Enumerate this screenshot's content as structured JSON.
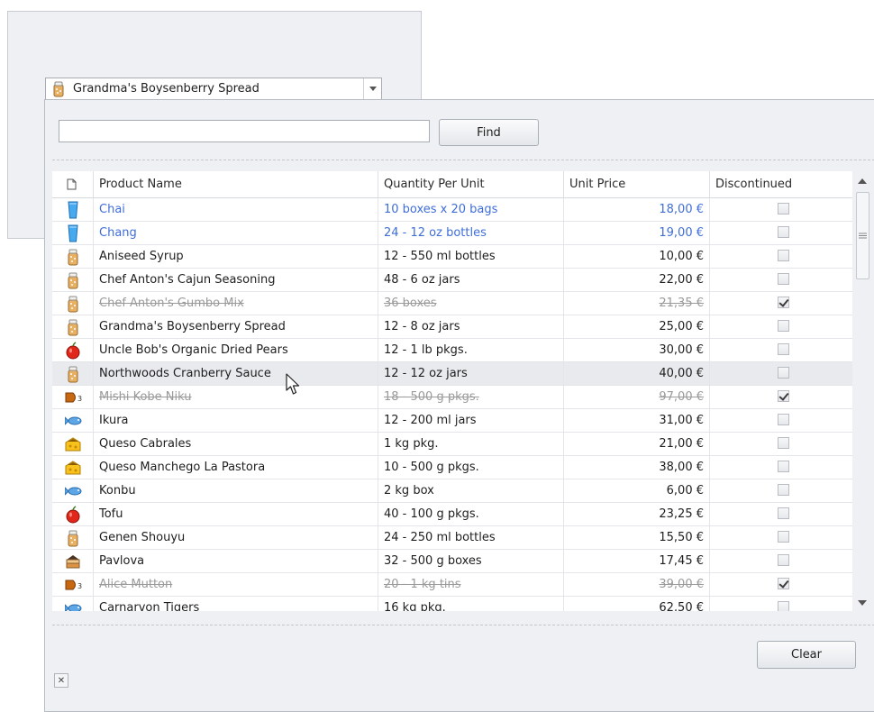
{
  "lookup": {
    "selected_value": "Grandma's Boysenberry Spread",
    "selected_icon": "jar-icon"
  },
  "popup": {
    "search_value": "",
    "find_label": "Find",
    "clear_label": "Clear",
    "close_glyph": "✕"
  },
  "grid": {
    "columns": [
      {
        "key": "icon",
        "label": ""
      },
      {
        "key": "name",
        "label": "Product Name"
      },
      {
        "key": "qty",
        "label": "Quantity Per Unit"
      },
      {
        "key": "price",
        "label": "Unit Price"
      },
      {
        "key": "disc",
        "label": "Discontinued"
      }
    ],
    "rows": [
      {
        "icon": "beverage-icon",
        "name": "Chai",
        "qty": "10 boxes x 20 bags",
        "price": "18,00 €",
        "discontinued": false,
        "style": "blue"
      },
      {
        "icon": "beverage-icon",
        "name": "Chang",
        "qty": "24 - 12 oz bottles",
        "price": "19,00 €",
        "discontinued": false,
        "style": "blue"
      },
      {
        "icon": "condiment-jar-icon",
        "name": "Aniseed Syrup",
        "qty": "12 - 550 ml bottles",
        "price": "10,00 €",
        "discontinued": false,
        "style": "normal"
      },
      {
        "icon": "condiment-jar-icon",
        "name": "Chef Anton's Cajun Seasoning",
        "qty": "48 - 6 oz jars",
        "price": "22,00 €",
        "discontinued": false,
        "style": "normal"
      },
      {
        "icon": "condiment-jar-icon",
        "name": "Chef Anton's Gumbo Mix",
        "qty": "36 boxes",
        "price": "21,35 €",
        "discontinued": true,
        "style": "strike"
      },
      {
        "icon": "condiment-jar-icon",
        "name": "Grandma's Boysenberry Spread",
        "qty": "12 - 8 oz jars",
        "price": "25,00 €",
        "discontinued": false,
        "style": "normal"
      },
      {
        "icon": "apple-icon",
        "name": "Uncle Bob's Organic Dried Pears",
        "qty": "12 - 1 lb pkgs.",
        "price": "30,00 €",
        "discontinued": false,
        "style": "normal"
      },
      {
        "icon": "condiment-jar-icon",
        "name": "Northwoods Cranberry Sauce",
        "qty": "12 - 12 oz jars",
        "price": "40,00 €",
        "discontinued": false,
        "style": "hover"
      },
      {
        "icon": "meat-icon",
        "name": "Mishi Kobe Niku",
        "qty": "18 - 500 g pkgs.",
        "price": "97,00 €",
        "discontinued": true,
        "style": "strike"
      },
      {
        "icon": "fish-icon",
        "name": "Ikura",
        "qty": "12 - 200 ml jars",
        "price": "31,00 €",
        "discontinued": false,
        "style": "normal"
      },
      {
        "icon": "cheese-icon",
        "name": "Queso Cabrales",
        "qty": "1 kg pkg.",
        "price": "21,00 €",
        "discontinued": false,
        "style": "normal"
      },
      {
        "icon": "cheese-icon",
        "name": "Queso Manchego La Pastora",
        "qty": "10 - 500 g pkgs.",
        "price": "38,00 €",
        "discontinued": false,
        "style": "normal"
      },
      {
        "icon": "fish-icon",
        "name": "Konbu",
        "qty": "2 kg box",
        "price": "6,00 €",
        "discontinued": false,
        "style": "normal"
      },
      {
        "icon": "apple-icon",
        "name": "Tofu",
        "qty": "40 - 100 g pkgs.",
        "price": "23,25 €",
        "discontinued": false,
        "style": "normal"
      },
      {
        "icon": "condiment-jar-icon",
        "name": "Genen Shouyu",
        "qty": "24 - 250 ml bottles",
        "price": "15,50 €",
        "discontinued": false,
        "style": "normal"
      },
      {
        "icon": "cake-icon",
        "name": "Pavlova",
        "qty": "32 - 500 g boxes",
        "price": "17,45 €",
        "discontinued": false,
        "style": "normal"
      },
      {
        "icon": "meat-icon",
        "name": "Alice Mutton",
        "qty": "20 - 1 kg tins",
        "price": "39,00 €",
        "discontinued": true,
        "style": "strike"
      },
      {
        "icon": "fish-icon",
        "name": "Carnarvon Tigers",
        "qty": "16 kg pkg.",
        "price": "62,50 €",
        "discontinued": false,
        "style": "normal"
      }
    ]
  }
}
